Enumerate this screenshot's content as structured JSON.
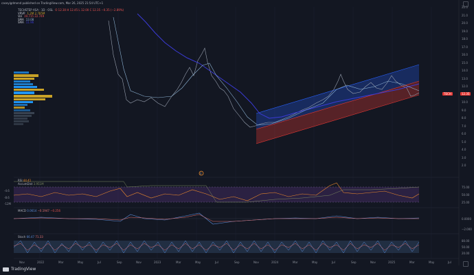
{
  "header": {
    "publish_line": "caseyigdmend published on TradingView.com, Mar 26, 2025 21:54 UTC+1"
  },
  "legend": {
    "symbol_line": "TECHSTEP ASA · 1D · OSL",
    "ohlc": "O 12.30  H 12.45  L 12.00  C 12.35  −0.35 (−2.89%)",
    "vrvp_label": "VRVP",
    "vrvp_values": "1.2M  2.785M",
    "vol_label": "Vol",
    "vol_values": "19.715  22.749",
    "sma1_label": "SMA",
    "sma1_value": "13.08",
    "sma2_label": "SMA",
    "sma2_value": "11.96"
  },
  "price_axis": {
    "ticks": [
      "22.0",
      "21.0",
      "20.0",
      "19.0",
      "18.0",
      "17.0",
      "16.0",
      "15.0",
      "14.0",
      "13.0",
      "12.0",
      "11.0",
      "10.0",
      "9.0",
      "8.0",
      "7.0",
      "6.0",
      "5.0",
      "4.0",
      "3.0",
      "2.0"
    ],
    "current_symbol_tag": "TECH",
    "current_price_tag": "12.35"
  },
  "rsi_pane": {
    "label": "RSI",
    "value": "44.41",
    "sub_label": "AccumDist",
    "sub_value": "3.951M",
    "left_values": [
      "-4.6",
      "-8.6",
      "-12M"
    ],
    "right_ticks": [
      "75.00",
      "50.00",
      "25.00"
    ]
  },
  "macd_pane": {
    "label": "MACD",
    "value1": "0.0614",
    "value2": "−0.1947",
    "value3": "−0.256",
    "right_ticks": [
      "0.0000",
      "−2.000"
    ]
  },
  "stoch_pane": {
    "label": "Stoch",
    "value1": "66.47",
    "value2": "71.33",
    "right_ticks": [
      "80.00",
      "50.00",
      "20.00"
    ]
  },
  "time_axis": {
    "labels": [
      "Nov",
      "2022",
      "Mar",
      "May",
      "Jul",
      "Sep",
      "Nov",
      "2023",
      "Mar",
      "May",
      "Jul",
      "Sep",
      "Nov",
      "2024",
      "Mar",
      "May",
      "Jul",
      "Sep",
      "Nov",
      "2025",
      "Mar",
      "May",
      "Jul"
    ]
  },
  "marker": {
    "label": "E"
  },
  "brand": {
    "name": "TradingView"
  },
  "colors": {
    "background": "#131722",
    "vp_gold": "#c9a227",
    "vp_blue": "#2196f3",
    "channel_blue": "#2962ff",
    "channel_red": "#e53935",
    "sma_blue": "#3b3bd6",
    "sma_teal": "#8fb5d6",
    "rsi_orange": "#f08c2c",
    "rsi_band": "#3f2a5c",
    "price_tag_red": "#e53935"
  }
}
